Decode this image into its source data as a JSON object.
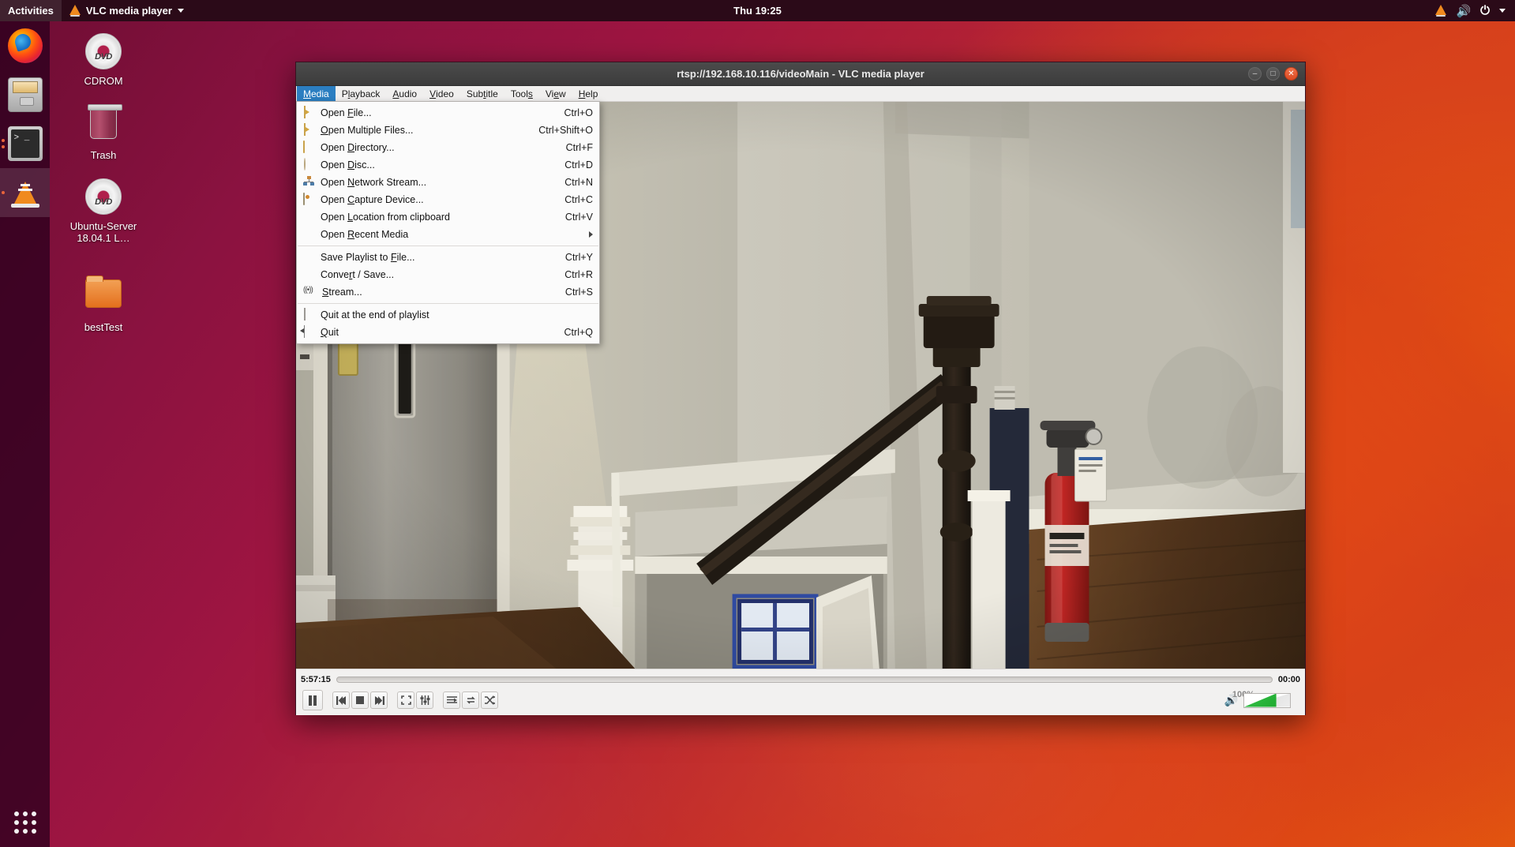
{
  "topbar": {
    "activities": "Activities",
    "app_menu": "VLC media player",
    "app_icon": "vlc-cone-icon",
    "clock": "Thu 19:25",
    "tray": [
      "vlc-cone-icon",
      "volume-icon",
      "power-icon",
      "caret-down-icon"
    ]
  },
  "dock": {
    "items": [
      {
        "name": "firefox",
        "label": "Firefox Web Browser",
        "dots": 0,
        "active": false
      },
      {
        "name": "files",
        "label": "Files",
        "dots": 0,
        "active": false
      },
      {
        "name": "terminal",
        "label": "Terminal",
        "dots": 2,
        "active": false
      },
      {
        "name": "vlc",
        "label": "VLC media player",
        "dots": 1,
        "active": true
      }
    ],
    "show_apps_label": "Show Applications"
  },
  "desktop_icons": [
    {
      "label": "CDROM",
      "icon": "dvd-disc-icon"
    },
    {
      "label": "Trash",
      "icon": "trash-icon"
    },
    {
      "label": "Ubuntu-Server 18.04.1 L…",
      "icon": "dvd-disc-icon"
    },
    {
      "label": "bestTest",
      "icon": "folder-icon"
    }
  ],
  "vlc": {
    "title": "rtsp://192.168.10.116/videoMain - VLC media player",
    "window_buttons": {
      "minimize": "–",
      "maximize": "□",
      "close": "✕"
    },
    "menubar": [
      {
        "id": "media",
        "label": "Media",
        "mnemonic": "M",
        "open": true
      },
      {
        "id": "playback",
        "label": "Playback",
        "mnemonic": "l",
        "open": false
      },
      {
        "id": "audio",
        "label": "Audio",
        "mnemonic": "A",
        "open": false
      },
      {
        "id": "video",
        "label": "Video",
        "mnemonic": "V",
        "open": false
      },
      {
        "id": "subtitle",
        "label": "Subtitle",
        "mnemonic": "t",
        "open": false
      },
      {
        "id": "tools",
        "label": "Tools",
        "mnemonic": "s",
        "open": false
      },
      {
        "id": "view",
        "label": "View",
        "mnemonic": "e",
        "open": false
      },
      {
        "id": "help",
        "label": "Help",
        "mnemonic": "H",
        "open": false
      }
    ],
    "media_menu": [
      {
        "type": "item",
        "icon": "file-icon",
        "label": "Open File...",
        "pre": "Open ",
        "mn": "F",
        "post": "ile...",
        "accel": "Ctrl+O"
      },
      {
        "type": "item",
        "icon": "file-icon",
        "label": "Open Multiple Files...",
        "pre": "",
        "mn": "O",
        "post": "pen Multiple Files...",
        "accel": "Ctrl+Shift+O"
      },
      {
        "type": "item",
        "icon": "folder-icon",
        "label": "Open Directory...",
        "pre": "Open ",
        "mn": "D",
        "post": "irectory...",
        "accel": "Ctrl+F"
      },
      {
        "type": "item",
        "icon": "disc-icon",
        "label": "Open Disc...",
        "pre": "Open ",
        "mn": "D",
        "post": "isc...",
        "accel": "Ctrl+D"
      },
      {
        "type": "item",
        "icon": "network-icon",
        "label": "Open Network Stream...",
        "pre": "Open ",
        "mn": "N",
        "post": "etwork Stream...",
        "accel": "Ctrl+N"
      },
      {
        "type": "item",
        "icon": "capture-icon",
        "label": "Open Capture Device...",
        "pre": "Open ",
        "mn": "C",
        "post": "apture Device...",
        "accel": "Ctrl+C"
      },
      {
        "type": "item",
        "icon": "none",
        "label": "Open Location from clipboard",
        "pre": "Open ",
        "mn": "L",
        "post": "ocation from clipboard",
        "accel": "Ctrl+V"
      },
      {
        "type": "submenu",
        "icon": "none",
        "label": "Open Recent Media",
        "pre": "Open ",
        "mn": "R",
        "post": "ecent Media",
        "accel": ""
      },
      {
        "type": "separator"
      },
      {
        "type": "item",
        "icon": "none",
        "label": "Save Playlist to File...",
        "pre": "Save Playlist to ",
        "mn": "F",
        "post": "ile...",
        "accel": "Ctrl+Y"
      },
      {
        "type": "item",
        "icon": "none",
        "label": "Convert / Save...",
        "pre": "Conve",
        "mn": "r",
        "post": "t / Save...",
        "accel": "Ctrl+R"
      },
      {
        "type": "item",
        "icon": "stream-icon",
        "label": "Stream...",
        "pre": "",
        "mn": "S",
        "post": "tream...",
        "accel": "Ctrl+S"
      },
      {
        "type": "separator"
      },
      {
        "type": "checkbox",
        "icon": "checkbox",
        "label": "Quit at the end of playlist",
        "pre": "Quit at the end of playlist",
        "mn": "",
        "post": "",
        "accel": "",
        "checked": false
      },
      {
        "type": "item",
        "icon": "quit-icon",
        "label": "Quit",
        "pre": "",
        "mn": "Q",
        "post": "uit",
        "accel": "Ctrl+Q"
      }
    ],
    "controls": {
      "elapsed": "5:57:15",
      "total": "00:00",
      "seek_percent": 0,
      "buttons": [
        {
          "name": "play-pause-button",
          "glyph": "pause"
        },
        {
          "name": "previous-button",
          "glyph": "prev"
        },
        {
          "name": "stop-button",
          "glyph": "stop"
        },
        {
          "name": "next-button",
          "glyph": "next"
        },
        {
          "name": "fullscreen-button",
          "glyph": "fullscreen"
        },
        {
          "name": "extended-settings-button",
          "glyph": "equalizer"
        },
        {
          "name": "playlist-button",
          "glyph": "playlist"
        },
        {
          "name": "loop-button",
          "glyph": "loop"
        },
        {
          "name": "random-button",
          "glyph": "shuffle"
        }
      ],
      "volume_label": "100%",
      "volume_percent": 100,
      "volume_icon": "speaker-icon"
    },
    "video_stream": {
      "description": "Live RTSP camera view of an interior hallway landing: grey panelled door at left, white baseboards and crown trim, a dark wooden newel post and stair railing at centre-right, a red fire extinguisher with hang tag, a blue-lit basement window at the stair bottom, and dark hardwood flooring.",
      "wall_color": "#c9c8bf",
      "floor_color": "#4b2f1d",
      "accent_color": "#b51f1c"
    }
  },
  "colors": {
    "ubuntu_purple": "#2c001e",
    "ubuntu_orange": "#e8560f",
    "menu_highlight": "#2b7ec1",
    "volume_green": "#25ab33"
  }
}
